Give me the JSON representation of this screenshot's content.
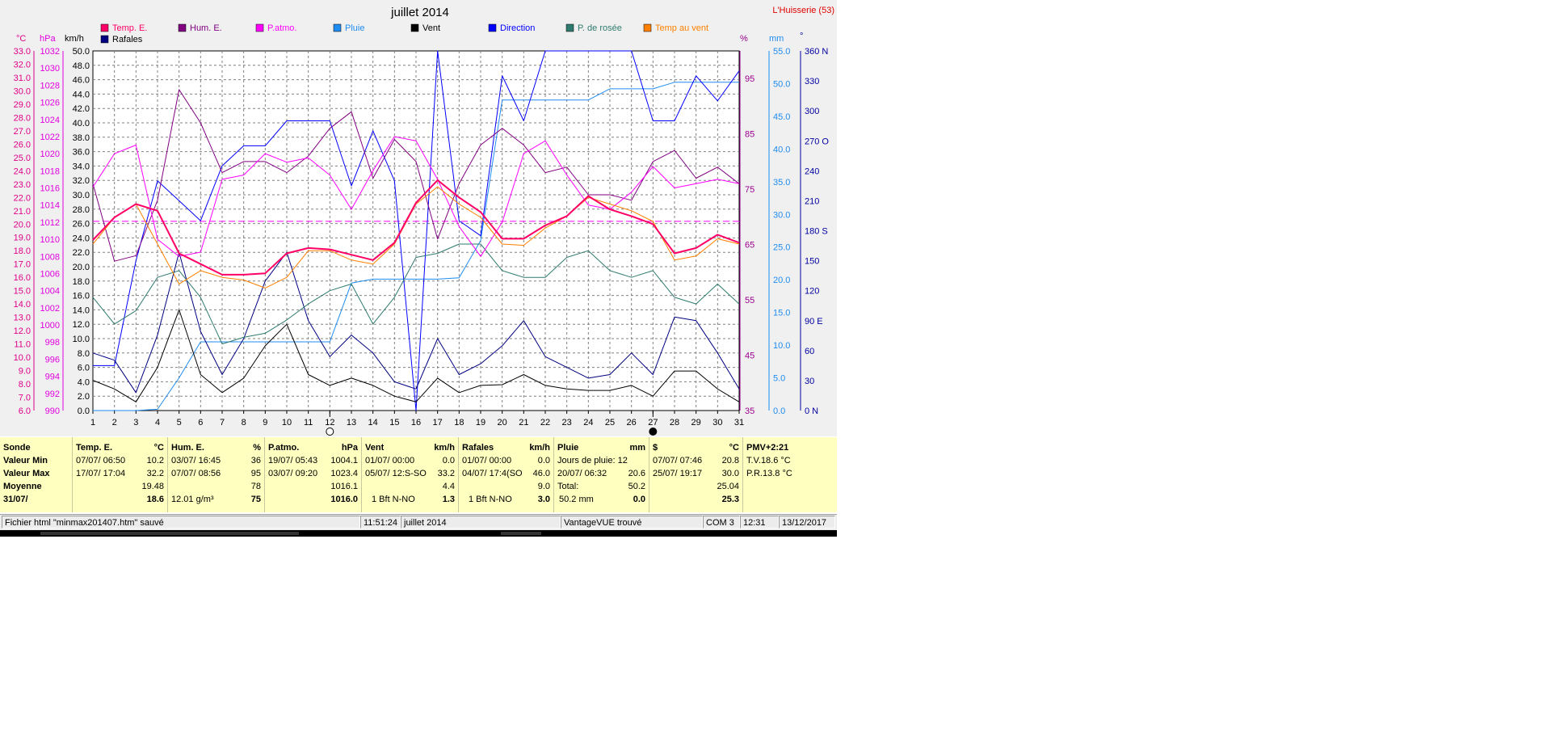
{
  "chart_data": {
    "type": "line",
    "title": "juillet 2014",
    "station": "L'Huisserie (53)",
    "x": [
      1,
      2,
      3,
      4,
      5,
      6,
      7,
      8,
      9,
      10,
      11,
      12,
      13,
      14,
      15,
      16,
      17,
      18,
      19,
      20,
      21,
      22,
      23,
      24,
      25,
      26,
      27,
      28,
      29,
      30,
      31
    ],
    "axes": {
      "temp": {
        "label": "°C",
        "min": 6.0,
        "max": 33.0,
        "step": 1.0,
        "decimals": 1
      },
      "hpa": {
        "label": "hPa",
        "min": 990,
        "max": 1032,
        "step": 2,
        "decimals": 0
      },
      "kmh": {
        "label": "km/h",
        "min": 0.0,
        "max": 50.0,
        "step": 2.0,
        "decimals": 1
      },
      "pct": {
        "label": "%",
        "min": 35,
        "max": 100,
        "ticks": [
          45,
          55,
          65,
          75,
          85,
          95
        ]
      },
      "mm": {
        "label": "mm",
        "min": 0.0,
        "max": 55.0,
        "step": 5.0,
        "decimals": 1
      },
      "deg": {
        "label": "°",
        "min": 0,
        "max": 360,
        "ticks": [
          0,
          30,
          60,
          90,
          120,
          150,
          180,
          210,
          240,
          270,
          300,
          330,
          360
        ],
        "tick_labels": [
          "0   N",
          "30",
          "60",
          "90   E",
          "120",
          "150",
          "180 S",
          "210",
          "240",
          "270 O",
          "300",
          "330",
          "360 N"
        ]
      }
    },
    "grid": true,
    "legend": [
      {
        "name": "Temp. E.",
        "color": "#ff0066"
      },
      {
        "name": "Hum. E.",
        "color": "#800080"
      },
      {
        "name": "P.atmo.",
        "color": "#ff00ff"
      },
      {
        "name": "Pluie",
        "color": "#1e8cf0"
      },
      {
        "name": "Vent",
        "color": "#000000"
      },
      {
        "name": "Direction",
        "color": "#0000ff"
      },
      {
        "name": "P. de rosée",
        "color": "#2e7a6e"
      },
      {
        "name": "Temp au vent",
        "color": "#ff8000"
      },
      {
        "name": "Rafales",
        "color": "#000080"
      }
    ],
    "series": [
      {
        "name": "Humidité moyenne",
        "axis": "pct",
        "color": "#ff00ff",
        "dashed": true,
        "values": [
          69.2,
          69.2,
          69.2,
          69.2,
          69.2,
          69.2,
          69.2,
          69.2,
          69.2,
          69.2,
          69.2,
          69.2,
          69.2,
          69.2,
          69.2,
          69.2,
          69.2,
          69.2,
          69.2,
          69.2,
          69.2,
          69.2,
          69.2,
          69.2,
          69.2,
          69.2,
          69.2,
          69.2,
          69.2,
          69.2,
          69.2
        ]
      },
      {
        "name": "Pluie",
        "axis": "mm",
        "color": "#1e8cf0",
        "width": 1,
        "values": [
          0.0,
          0.0,
          0.0,
          0.2,
          5.0,
          10.5,
          10.5,
          10.5,
          10.5,
          10.5,
          10.5,
          10.5,
          19.5,
          20.1,
          20.1,
          20.1,
          20.1,
          20.3,
          26.0,
          47.5,
          47.5,
          47.5,
          47.5,
          47.5,
          49.2,
          49.2,
          49.2,
          50.2,
          50.2,
          50.2,
          50.2
        ]
      },
      {
        "name": "Direction",
        "axis": "deg",
        "color": "#0000ff",
        "width": 1,
        "values": [
          45,
          45,
          150,
          230,
          210,
          190,
          245,
          265,
          265,
          290,
          290,
          290,
          225,
          280,
          230,
          0,
          360,
          190,
          175,
          335,
          290,
          360,
          360,
          360,
          360,
          360,
          290,
          290,
          335,
          310,
          340
        ]
      },
      {
        "name": "Rafales",
        "axis": "kmh",
        "color": "#000080",
        "width": 1,
        "values": [
          8.0,
          7.0,
          2.5,
          10.5,
          22.0,
          11.0,
          5.0,
          10.0,
          18.0,
          22.0,
          12.5,
          7.5,
          10.5,
          8.0,
          4.0,
          3.0,
          10.0,
          5.0,
          6.5,
          9.0,
          12.5,
          7.5,
          6.0,
          4.5,
          5.0,
          8.0,
          5.0,
          13.0,
          12.5,
          8.0,
          3.0
        ]
      },
      {
        "name": "Vent",
        "axis": "kmh",
        "color": "#000000",
        "width": 1,
        "values": [
          4.2,
          3.0,
          1.2,
          6.0,
          14.0,
          5.0,
          2.5,
          4.5,
          9.0,
          12.0,
          5.0,
          3.5,
          4.5,
          3.5,
          2.0,
          1.2,
          4.5,
          2.5,
          3.5,
          3.6,
          5.0,
          3.5,
          3.0,
          2.8,
          2.8,
          3.5,
          2.0,
          5.5,
          5.5,
          3.0,
          1.2
        ]
      },
      {
        "name": "P. de rosée",
        "axis": "temp",
        "color": "#2e7a6e",
        "width": 1,
        "values": [
          14.5,
          12.5,
          13.5,
          16.0,
          16.5,
          14.5,
          11.0,
          11.5,
          11.8,
          12.8,
          14.0,
          15.0,
          15.5,
          12.5,
          14.5,
          17.5,
          17.8,
          18.5,
          18.5,
          16.5,
          16.0,
          16.0,
          17.5,
          18.0,
          16.5,
          16.0,
          16.5,
          14.5,
          14.0,
          15.5,
          14.0
        ]
      },
      {
        "name": "Hum. E.",
        "axis": "pct",
        "color": "#800080",
        "width": 1,
        "values": [
          76,
          62,
          63,
          73,
          93,
          87,
          78,
          80,
          80,
          78,
          81,
          86,
          89,
          77,
          84,
          80,
          66,
          76,
          83,
          86,
          83,
          78,
          79,
          74,
          74,
          73,
          80,
          82,
          77,
          79,
          76
        ]
      },
      {
        "name": "P.atmo.",
        "axis": "hpa",
        "color": "#ff00ff",
        "width": 1,
        "values": [
          1016.1,
          1020.0,
          1021.0,
          1010.0,
          1008.0,
          1008.5,
          1017.0,
          1017.5,
          1020.0,
          1019.0,
          1019.5,
          1017.5,
          1013.5,
          1018.0,
          1022.0,
          1021.5,
          1017.0,
          1011.5,
          1008.0,
          1012.0,
          1020.0,
          1021.5,
          1017.5,
          1014.0,
          1013.5,
          1015.5,
          1018.5,
          1016.0,
          1016.5,
          1017.0,
          1016.5
        ]
      },
      {
        "name": "Temp au vent",
        "axis": "temp",
        "color": "#ff8000",
        "width": 1,
        "values": [
          18.5,
          20.5,
          21.5,
          18.5,
          15.5,
          16.5,
          16.0,
          15.8,
          15.2,
          16.0,
          18.0,
          18.0,
          17.3,
          17.0,
          18.5,
          21.5,
          22.8,
          21.5,
          20.5,
          18.5,
          18.4,
          19.7,
          20.6,
          22.0,
          21.5,
          21.0,
          20.2,
          17.3,
          17.6,
          18.9,
          18.5
        ]
      },
      {
        "name": "Temp. E.",
        "axis": "temp",
        "color": "#ff0066",
        "width": 2,
        "values": [
          18.8,
          20.5,
          21.5,
          21.0,
          17.8,
          17.0,
          16.2,
          16.2,
          16.3,
          17.8,
          18.2,
          18.1,
          17.7,
          17.3,
          18.6,
          21.6,
          23.3,
          22.0,
          20.9,
          18.9,
          18.9,
          19.9,
          20.6,
          22.1,
          21.1,
          20.6,
          20.0,
          17.8,
          18.2,
          19.2,
          18.6
        ]
      }
    ],
    "markers": [
      {
        "day": 12,
        "symbol": "○"
      },
      {
        "day": 27,
        "symbol": "●"
      }
    ]
  },
  "stats": {
    "headers": [
      "Sonde",
      "Valeur Min",
      "Valeur Max",
      "Moyenne",
      "31/07/"
    ],
    "temp": {
      "title": "Temp. E.",
      "unit": "°C",
      "min_ts": "07/07/  06:50",
      "min": "10.2",
      "max_ts": "17/07/  17:04",
      "max": "32.2",
      "avg": "19.48",
      "last": "18.6"
    },
    "hum": {
      "title": "Hum. E.",
      "unit": "%",
      "min_ts": "03/07/  16:45",
      "min": "36",
      "max_ts": "07/07/  08:56",
      "max": "95",
      "avg": "78",
      "extra": "12.01 g/m³",
      "last": "75"
    },
    "patmo": {
      "title": "P.atmo.",
      "unit": "hPa",
      "min_ts": "19/07/  05:43",
      "min": "1004.1",
      "max_ts": "03/07/  09:20",
      "max": "1023.4",
      "avg": "1016.1",
      "last": "1016.0"
    },
    "vent": {
      "title": "Vent",
      "unit": "km/h",
      "min_ts": "01/07/  00:00",
      "min": "0.0",
      "max_ts": "05/07/  12:S-SO",
      "max": "33.2",
      "avg": "4.4",
      "extra": "1 Bft N-NO",
      "last": "1.3"
    },
    "rafales": {
      "title": "Rafales",
      "unit": "km/h",
      "min_ts": "01/07/  00:00",
      "min": "0.0",
      "max_ts": "04/07/  17:4(SO",
      "max": "46.0",
      "avg": "9.0",
      "extra": "1 Bft N-NO",
      "last": "3.0"
    },
    "pluie": {
      "title": "Pluie",
      "unit": "mm",
      "row1": "Jours de pluie: 12",
      "max_ts": "20/07/  06:32",
      "max": "20.6",
      "total_label": "Total:",
      "total": "50.2",
      "extra": "50.2 mm",
      "last": "0.0"
    },
    "ssec": {
      "title": "$",
      "unit": "°C",
      "min_ts": "07/07/  07:46",
      "min": "20.8",
      "max_ts": "25/07/  19:17",
      "max": "30.0",
      "avg": "25.04",
      "last": "25.3"
    },
    "pmv": {
      "title": "PMV+2:21",
      "tv": "T.V.18.6 °C",
      "pr": "P.R.13.8 °C"
    }
  },
  "status": {
    "file": "Fichier html  \"minmax201407.htm\"  sauvé",
    "time": "11:51:24",
    "period": "juillet 2014",
    "device": "VantageVUE trouvé",
    "port": "COM 3",
    "clock": "12:31",
    "date": "13/12/2017"
  }
}
